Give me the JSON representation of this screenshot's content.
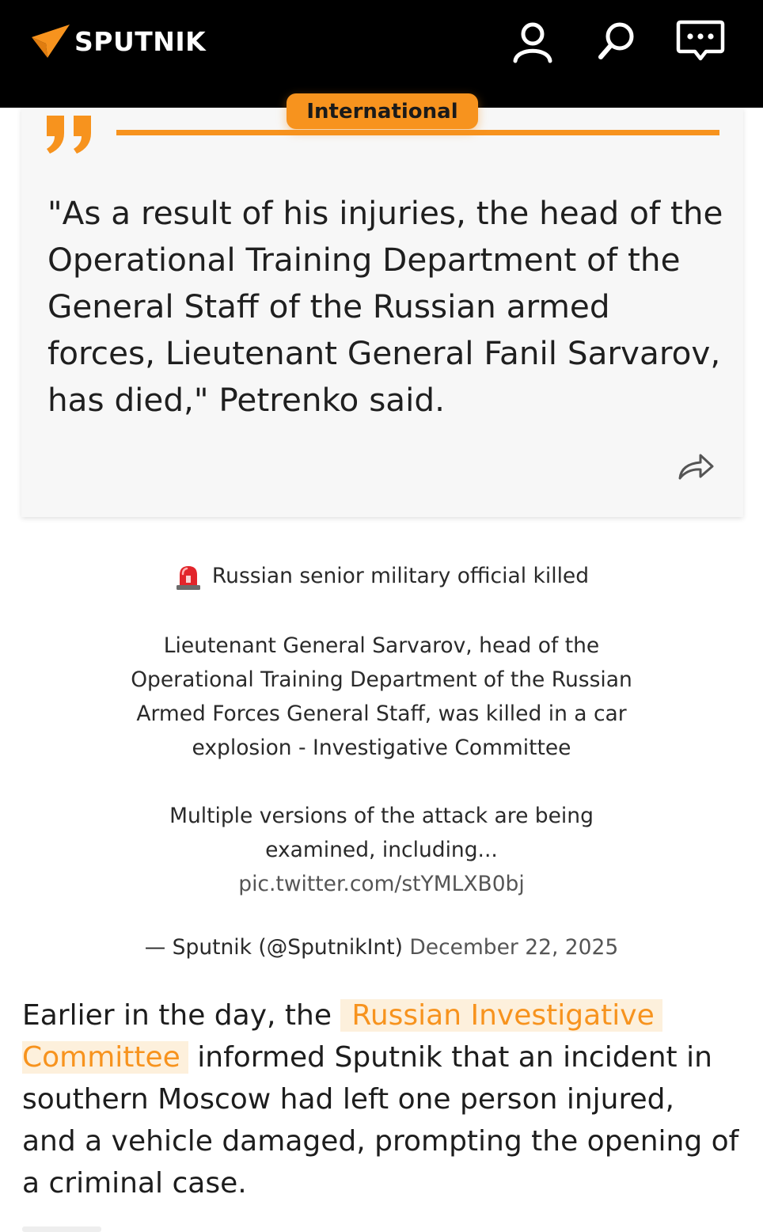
{
  "header": {
    "logo_text": "SPUTNIK",
    "logo_icon": "sputnik-arrow-logo",
    "background_color": "#000000",
    "icons": [
      "user-icon",
      "search-icon",
      "chat-icon"
    ]
  },
  "accent_color": "#f7931e",
  "category": "International",
  "quote": {
    "icon": "quote-icon",
    "lines": [
      "\"As a result of his injuries, the head of the",
      "Operational Training Department of the",
      "General Staff of the Russian armed",
      "forces, Lieutenant General Fanil Sarvarov,",
      "has died,\" Petrenko said."
    ],
    "share_icon": "share-icon"
  },
  "tweet": {
    "siren_icon": "siren-icon",
    "headline": "Russian senior military official killed",
    "paragraph1_lines": [
      "Lieutenant General Sarvarov, head of the",
      "Operational Training Department of the Russian",
      "Armed Forces General Staff, was killed in a car",
      "explosion - Investigative Committee"
    ],
    "paragraph2_lines": [
      "Multiple versions of the attack are being",
      "examined, including..."
    ],
    "pic_link": "pic.twitter.com/stYMLXB0bj",
    "attribution": "— Sputnik (@SputnikInt)",
    "date": "December 22, 2025"
  },
  "body": {
    "line1_prefix": "Earlier in the day, the ",
    "link_part1": "Russian Investigative",
    "link_part2": "Committee",
    "line2_suffix": " informed Sputnik that an incident in",
    "line3": "southern Moscow had left one person injured,",
    "line4": "and a vehicle damaged, prompting the opening of",
    "line5": "a criminal case."
  }
}
